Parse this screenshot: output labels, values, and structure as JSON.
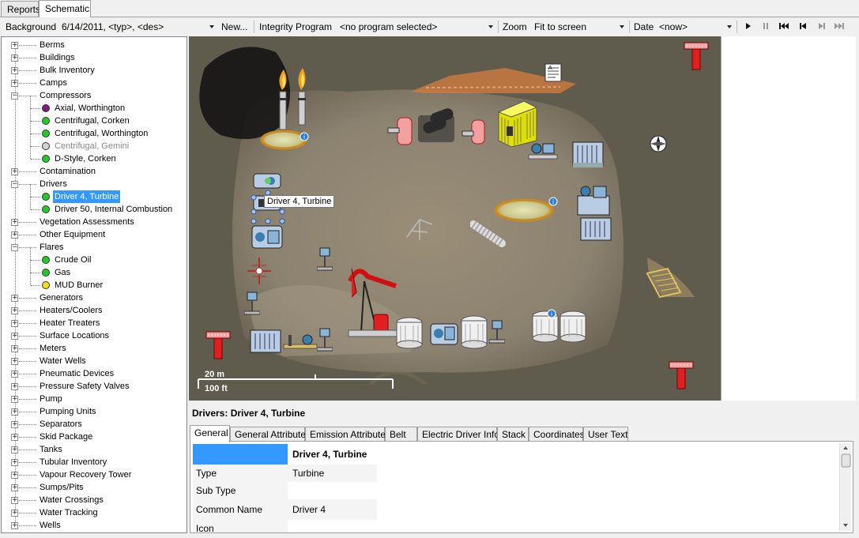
{
  "tabs": [
    {
      "label": "Reports",
      "active": false
    },
    {
      "label": "Schematic",
      "active": true
    }
  ],
  "toolbar": {
    "background_label": "Background",
    "background_value": "6/14/2011, <typ>, <des>",
    "new_label": "New...",
    "integrity_label": "Integrity Program",
    "integrity_value": "<no program selected>",
    "zoom_label": "Zoom",
    "zoom_value": "Fit to screen",
    "date_label": "Date",
    "date_value": "<now>"
  },
  "tree": [
    {
      "label": "Berms",
      "level": 0,
      "expander": "+"
    },
    {
      "label": "Buildings",
      "level": 0,
      "expander": "+"
    },
    {
      "label": "Bulk Inventory",
      "level": 0,
      "expander": "+"
    },
    {
      "label": "Camps",
      "level": 0,
      "expander": "+"
    },
    {
      "label": "Compressors",
      "level": 0,
      "expander": "-"
    },
    {
      "label": "Axial, Worthington",
      "level": 1,
      "status": "#7b1f7b"
    },
    {
      "label": "Centrifugal, Corken",
      "level": 1,
      "status": "#22cc22"
    },
    {
      "label": "Centrifugal, Worthington",
      "level": 1,
      "status": "#22cc22"
    },
    {
      "label": "Centrifugal, Gemini",
      "level": 1,
      "status": "#d4d4d4",
      "disabled": true
    },
    {
      "label": "D-Style, Corken",
      "level": 1,
      "status": "#22cc22"
    },
    {
      "label": "Contamination",
      "level": 0,
      "expander": "+"
    },
    {
      "label": "Drivers",
      "level": 0,
      "expander": "-"
    },
    {
      "label": "Driver 4, Turbine",
      "level": 1,
      "status": "#22cc22",
      "selected": true
    },
    {
      "label": "Driver 50, Internal Combustion",
      "level": 1,
      "status": "#22cc22"
    },
    {
      "label": "Vegetation Assessments",
      "level": 0,
      "expander": "+"
    },
    {
      "label": "Other Equipment",
      "level": 0,
      "expander": "+"
    },
    {
      "label": "Flares",
      "level": 0,
      "expander": "-"
    },
    {
      "label": "Crude Oil",
      "level": 1,
      "status": "#22cc22"
    },
    {
      "label": "Gas",
      "level": 1,
      "status": "#22cc22"
    },
    {
      "label": "MUD Burner",
      "level": 1,
      "status": "#f0e020"
    },
    {
      "label": "Generators",
      "level": 0,
      "expander": "+"
    },
    {
      "label": "Heaters/Coolers",
      "level": 0,
      "expander": "+"
    },
    {
      "label": "Heater Treaters",
      "level": 0,
      "expander": "+"
    },
    {
      "label": "Surface Locations",
      "level": 0,
      "expander": "+"
    },
    {
      "label": "Meters",
      "level": 0,
      "expander": "+"
    },
    {
      "label": "Water Wells",
      "level": 0,
      "expander": "+"
    },
    {
      "label": "Pneumatic Devices",
      "level": 0,
      "expander": "+"
    },
    {
      "label": "Pressure Safety Valves",
      "level": 0,
      "expander": "+"
    },
    {
      "label": "Pump",
      "level": 0,
      "expander": "+"
    },
    {
      "label": "Pumping Units",
      "level": 0,
      "expander": "+"
    },
    {
      "label": "Separators",
      "level": 0,
      "expander": "+"
    },
    {
      "label": "Skid Package",
      "level": 0,
      "expander": "+"
    },
    {
      "label": "Tanks",
      "level": 0,
      "expander": "+"
    },
    {
      "label": "Tubular Inventory",
      "level": 0,
      "expander": "+"
    },
    {
      "label": "Vapour Recovery Tower",
      "level": 0,
      "expander": "+"
    },
    {
      "label": "Sumps/Pits",
      "level": 0,
      "expander": "+"
    },
    {
      "label": "Water Crossings",
      "level": 0,
      "expander": "+"
    },
    {
      "label": "Water Tracking",
      "level": 0,
      "expander": "+"
    },
    {
      "label": "Wells",
      "level": 0,
      "expander": "+"
    }
  ],
  "map": {
    "tooltip": "Driver 4, Turbine",
    "scale_metric": "20 m",
    "scale_imperial": "100 ft"
  },
  "details": {
    "title": "Drivers: Driver 4, Turbine",
    "tabs": [
      "General",
      "General Attributes",
      "Emission Attributes",
      "Belt",
      "Electric Driver Info",
      "Stack",
      "Coordinates",
      "User Text"
    ],
    "active_tab": "General",
    "header_value": "Driver 4, Turbine",
    "header_color": "#3399ff",
    "rows": [
      {
        "key": "Type",
        "value": "Turbine"
      },
      {
        "key": "Sub Type",
        "value": ""
      },
      {
        "key": "Common Name",
        "value": "Driver 4"
      },
      {
        "key": "Icon",
        "value": ""
      }
    ]
  }
}
